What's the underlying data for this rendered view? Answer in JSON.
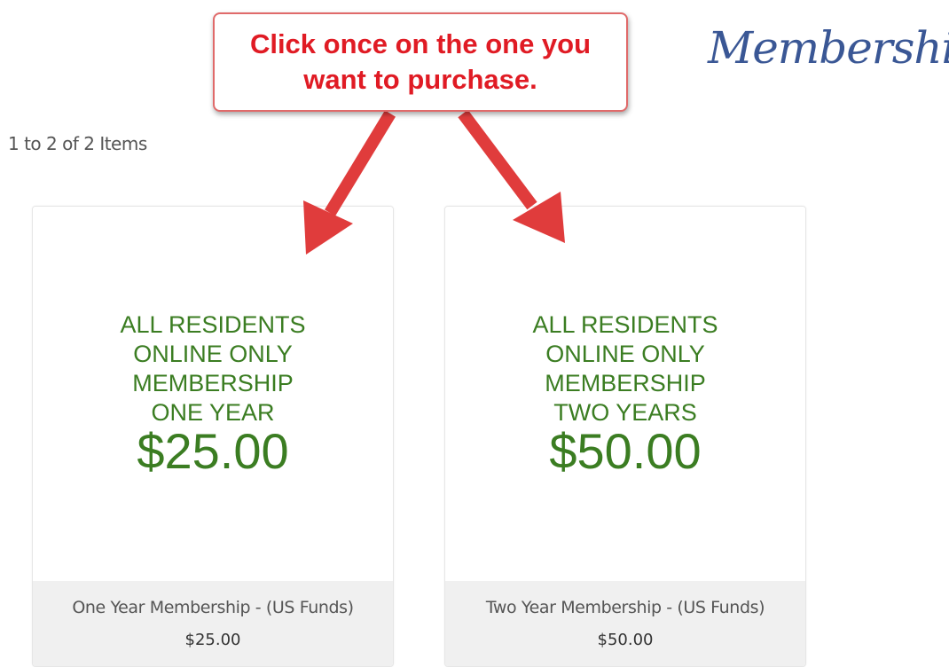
{
  "page": {
    "title": "Membership"
  },
  "callout": {
    "line1": "Click once on the one you",
    "line2": "want to purchase."
  },
  "listing": {
    "item_count": "1 to 2 of 2 Items"
  },
  "colors": {
    "title": "#3a5795",
    "callout_text": "#e01b24",
    "arrow": "#e03c3c",
    "promo_text": "#3b7d22",
    "card_footer_bg": "#f0f0f0"
  },
  "products": [
    {
      "promo": {
        "line1": "ALL RESIDENTS",
        "line2": "ONLINE ONLY",
        "line3": "MEMBERSHIP",
        "line4": "ONE YEAR",
        "price": "$25.00"
      },
      "name": "One Year Membership - (US Funds)",
      "price": "$25.00"
    },
    {
      "promo": {
        "line1": "ALL RESIDENTS",
        "line2": "ONLINE ONLY",
        "line3": "MEMBERSHIP",
        "line4": "TWO YEARS",
        "price": "$50.00"
      },
      "name": "Two Year Membership - (US Funds)",
      "price": "$50.00"
    }
  ]
}
